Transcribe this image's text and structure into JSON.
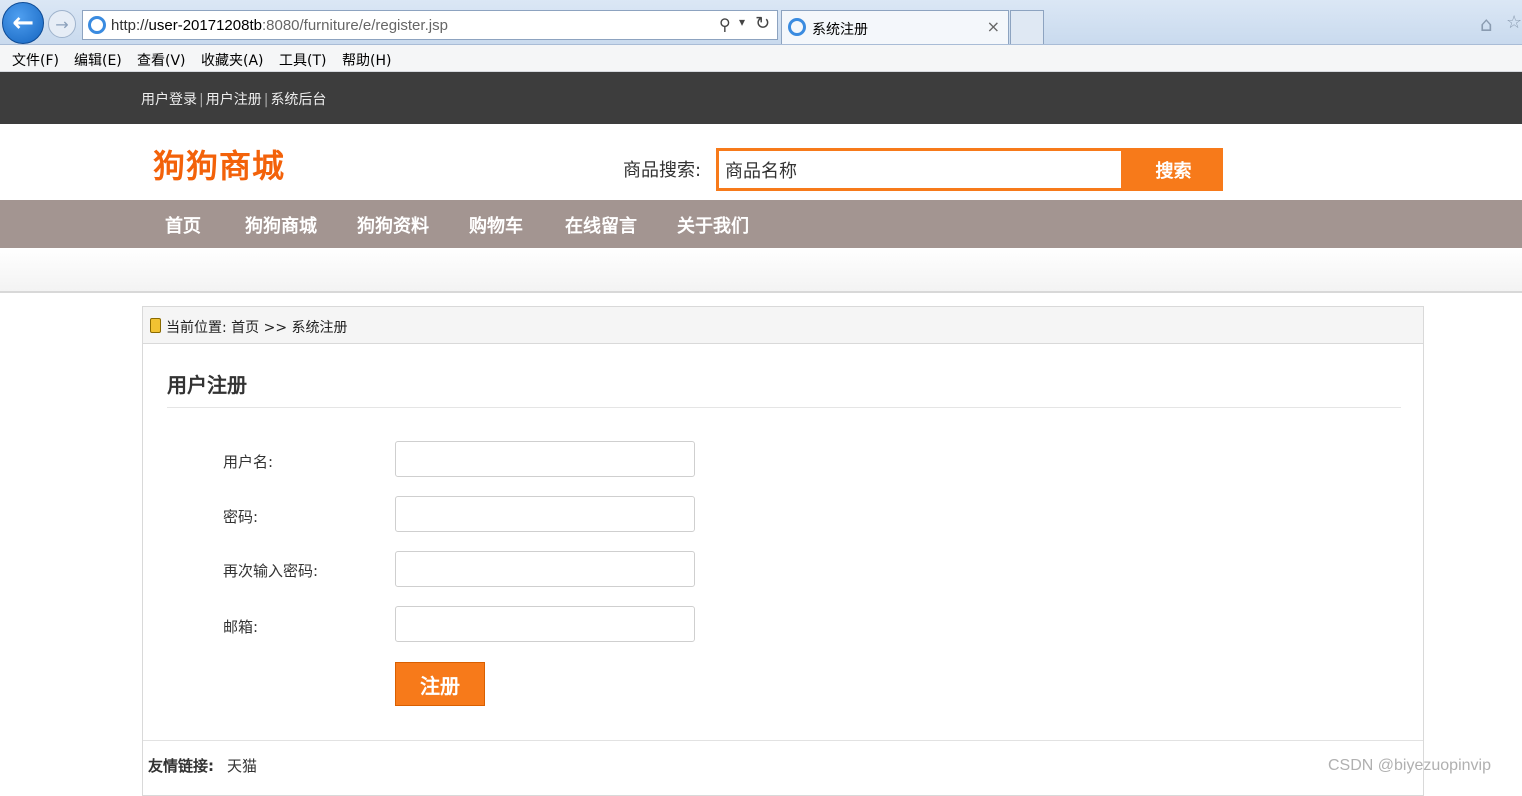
{
  "browser": {
    "url_prefix": "http://",
    "url_host": "user-20171208tb",
    "url_path": ":8080/furniture/e/register.jsp",
    "tab_title": "系统注册",
    "tab_close": "×"
  },
  "menubar": [
    "文件(F)",
    "编辑(E)",
    "查看(V)",
    "收藏夹(A)",
    "工具(T)",
    "帮助(H)"
  ],
  "topbar": {
    "links": [
      "用户登录",
      "用户注册",
      "系统后台"
    ],
    "separator": "|"
  },
  "header": {
    "logo": "狗狗商城",
    "search_label": "商品搜索:",
    "search_value": "商品名称",
    "search_button": "搜索"
  },
  "nav": [
    "首页",
    "狗狗商城",
    "狗狗资料",
    "购物车",
    "在线留言",
    "关于我们"
  ],
  "breadcrumb": "当前位置: 首页 >> 系统注册",
  "form": {
    "title": "用户注册",
    "fields": [
      {
        "label": "用户名:",
        "value": ""
      },
      {
        "label": "密码:",
        "value": ""
      },
      {
        "label": "再次输入密码:",
        "value": ""
      },
      {
        "label": "邮箱:",
        "value": ""
      }
    ],
    "submit": "注册"
  },
  "footer": {
    "friend_label": "友情链接:",
    "friend_link": "天猫"
  },
  "watermark": "CSDN @biyezuopinvip",
  "colors": {
    "accent": "#f77a1a",
    "topbar": "#3d3d3d",
    "nav": "#a39591"
  }
}
